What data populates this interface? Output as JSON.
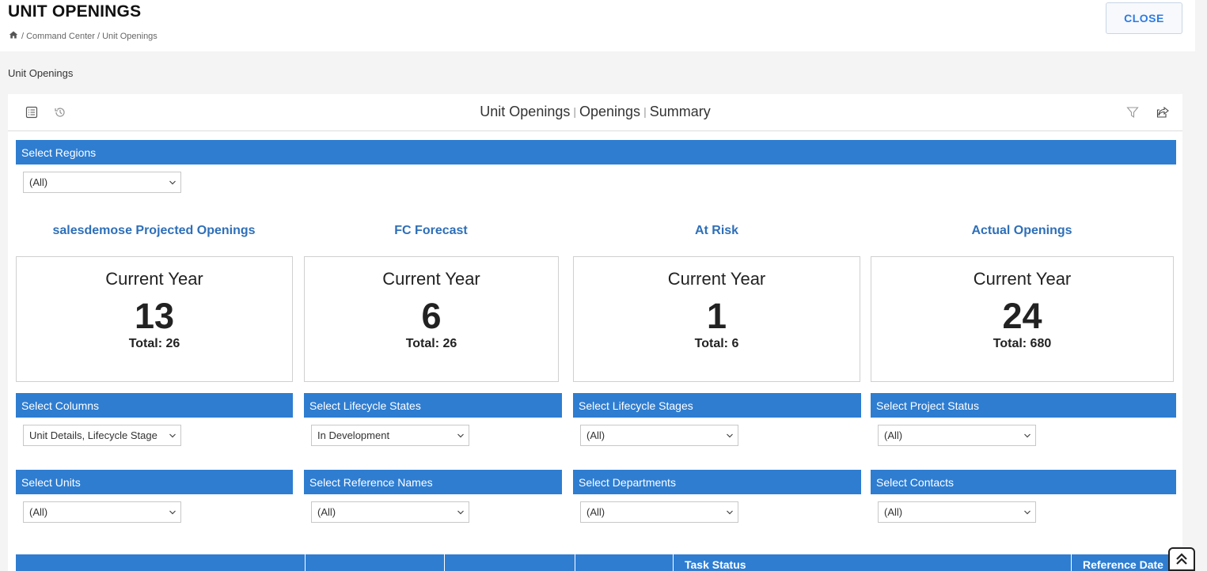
{
  "header": {
    "title": "UNIT OPENINGS",
    "breadcrumb": [
      "/ Command Center / Unit Openings"
    ],
    "close_label": "CLOSE"
  },
  "section_label": "Unit Openings",
  "panel": {
    "title_parts": [
      "Unit Openings",
      "Openings",
      "Summary"
    ],
    "separator": "|"
  },
  "filters": {
    "regions": {
      "label": "Select Regions",
      "value": "(All)"
    },
    "columns": {
      "label": "Select Columns",
      "value": "Unit Details, Lifecycle Stage"
    },
    "lifecycle_states": {
      "label": "Select Lifecycle States",
      "value": "In Development"
    },
    "lifecycle_stages": {
      "label": "Select Lifecycle Stages",
      "value": "(All)"
    },
    "project_status": {
      "label": "Select Project Status",
      "value": "(All)"
    },
    "units": {
      "label": "Select Units",
      "value": "(All)"
    },
    "reference_names": {
      "label": "Select Reference Names",
      "value": "(All)"
    },
    "departments": {
      "label": "Select Departments",
      "value": "(All)"
    },
    "contacts": {
      "label": "Select Contacts",
      "value": "(All)"
    }
  },
  "kpis": [
    {
      "title": "salesdemose Projected Openings",
      "period": "Current Year",
      "value": "13",
      "total": "Total: 26"
    },
    {
      "title": "FC Forecast",
      "period": "Current Year",
      "value": "6",
      "total": "Total: 26"
    },
    {
      "title": "At Risk",
      "period": "Current Year",
      "value": "1",
      "total": "Total: 6"
    },
    {
      "title": "Actual Openings",
      "period": "Current Year",
      "value": "24",
      "total": "Total: 680"
    }
  ],
  "table": {
    "headers": [
      "",
      "",
      "",
      "",
      "Task Status",
      "Reference Date"
    ]
  },
  "colors": {
    "accent": "#2e7dd1",
    "kpi_title": "#2e6fb8",
    "close_text": "#2c7be5"
  }
}
